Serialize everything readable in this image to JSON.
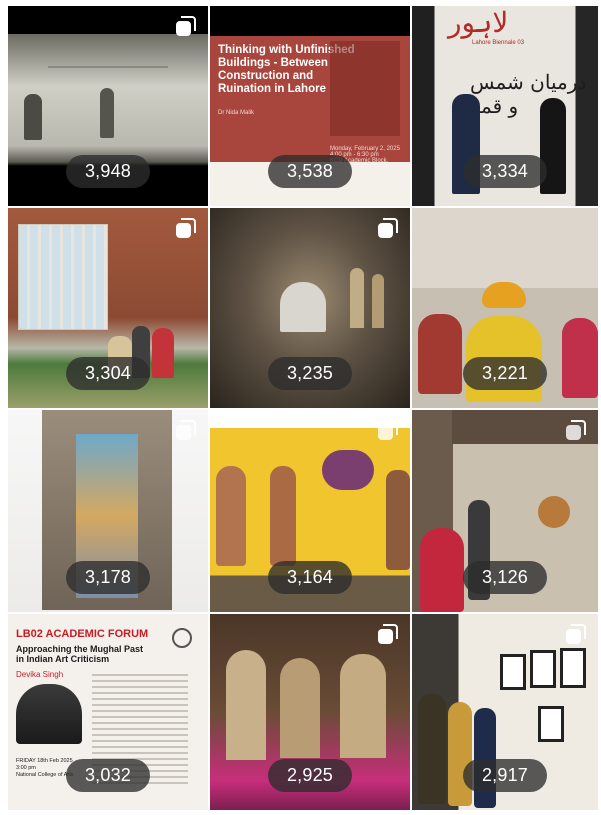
{
  "posts": [
    {
      "view_count": "3,948",
      "multi": true
    },
    {
      "view_count": "3,538",
      "multi": false,
      "poster": {
        "title": "Thinking with Unfinished\nBuildings - Between\nConstruction and\nRuination in Lahore",
        "speaker": "Dr Nida Malik",
        "details": "Monday, February 2, 2025\n4:00 pm - 6:30 pm\nKCD Academic Block, LUMS"
      }
    },
    {
      "view_count": "3,334",
      "multi": false,
      "banner": {
        "script": "لاہور",
        "caption": "Lahore Biennale 03",
        "urdu": "درمیان شمس و قمر"
      }
    },
    {
      "view_count": "3,304",
      "multi": true
    },
    {
      "view_count": "3,235",
      "multi": true
    },
    {
      "view_count": "3,221",
      "multi": false
    },
    {
      "view_count": "3,178",
      "multi": true
    },
    {
      "view_count": "3,164",
      "multi": true
    },
    {
      "view_count": "3,126",
      "multi": true
    },
    {
      "view_count": "3,032",
      "multi": false,
      "forum": {
        "title": "LB02 ACADEMIC FORUM",
        "subtitle": "Approaching the Mughal Past\nin Indian Art Criticism",
        "speaker": "Devika Singh",
        "info": "FRIDAY 18th Feb 2025\n3:00 pm\nNational College of Arts"
      }
    },
    {
      "view_count": "2,925",
      "multi": true
    },
    {
      "view_count": "2,917",
      "multi": true
    }
  ],
  "colors": {
    "badge_bg": "#2d2d2d",
    "badge_text": "#ffffff",
    "poster_red": "#a8453d",
    "forum_red": "#c61d24"
  }
}
